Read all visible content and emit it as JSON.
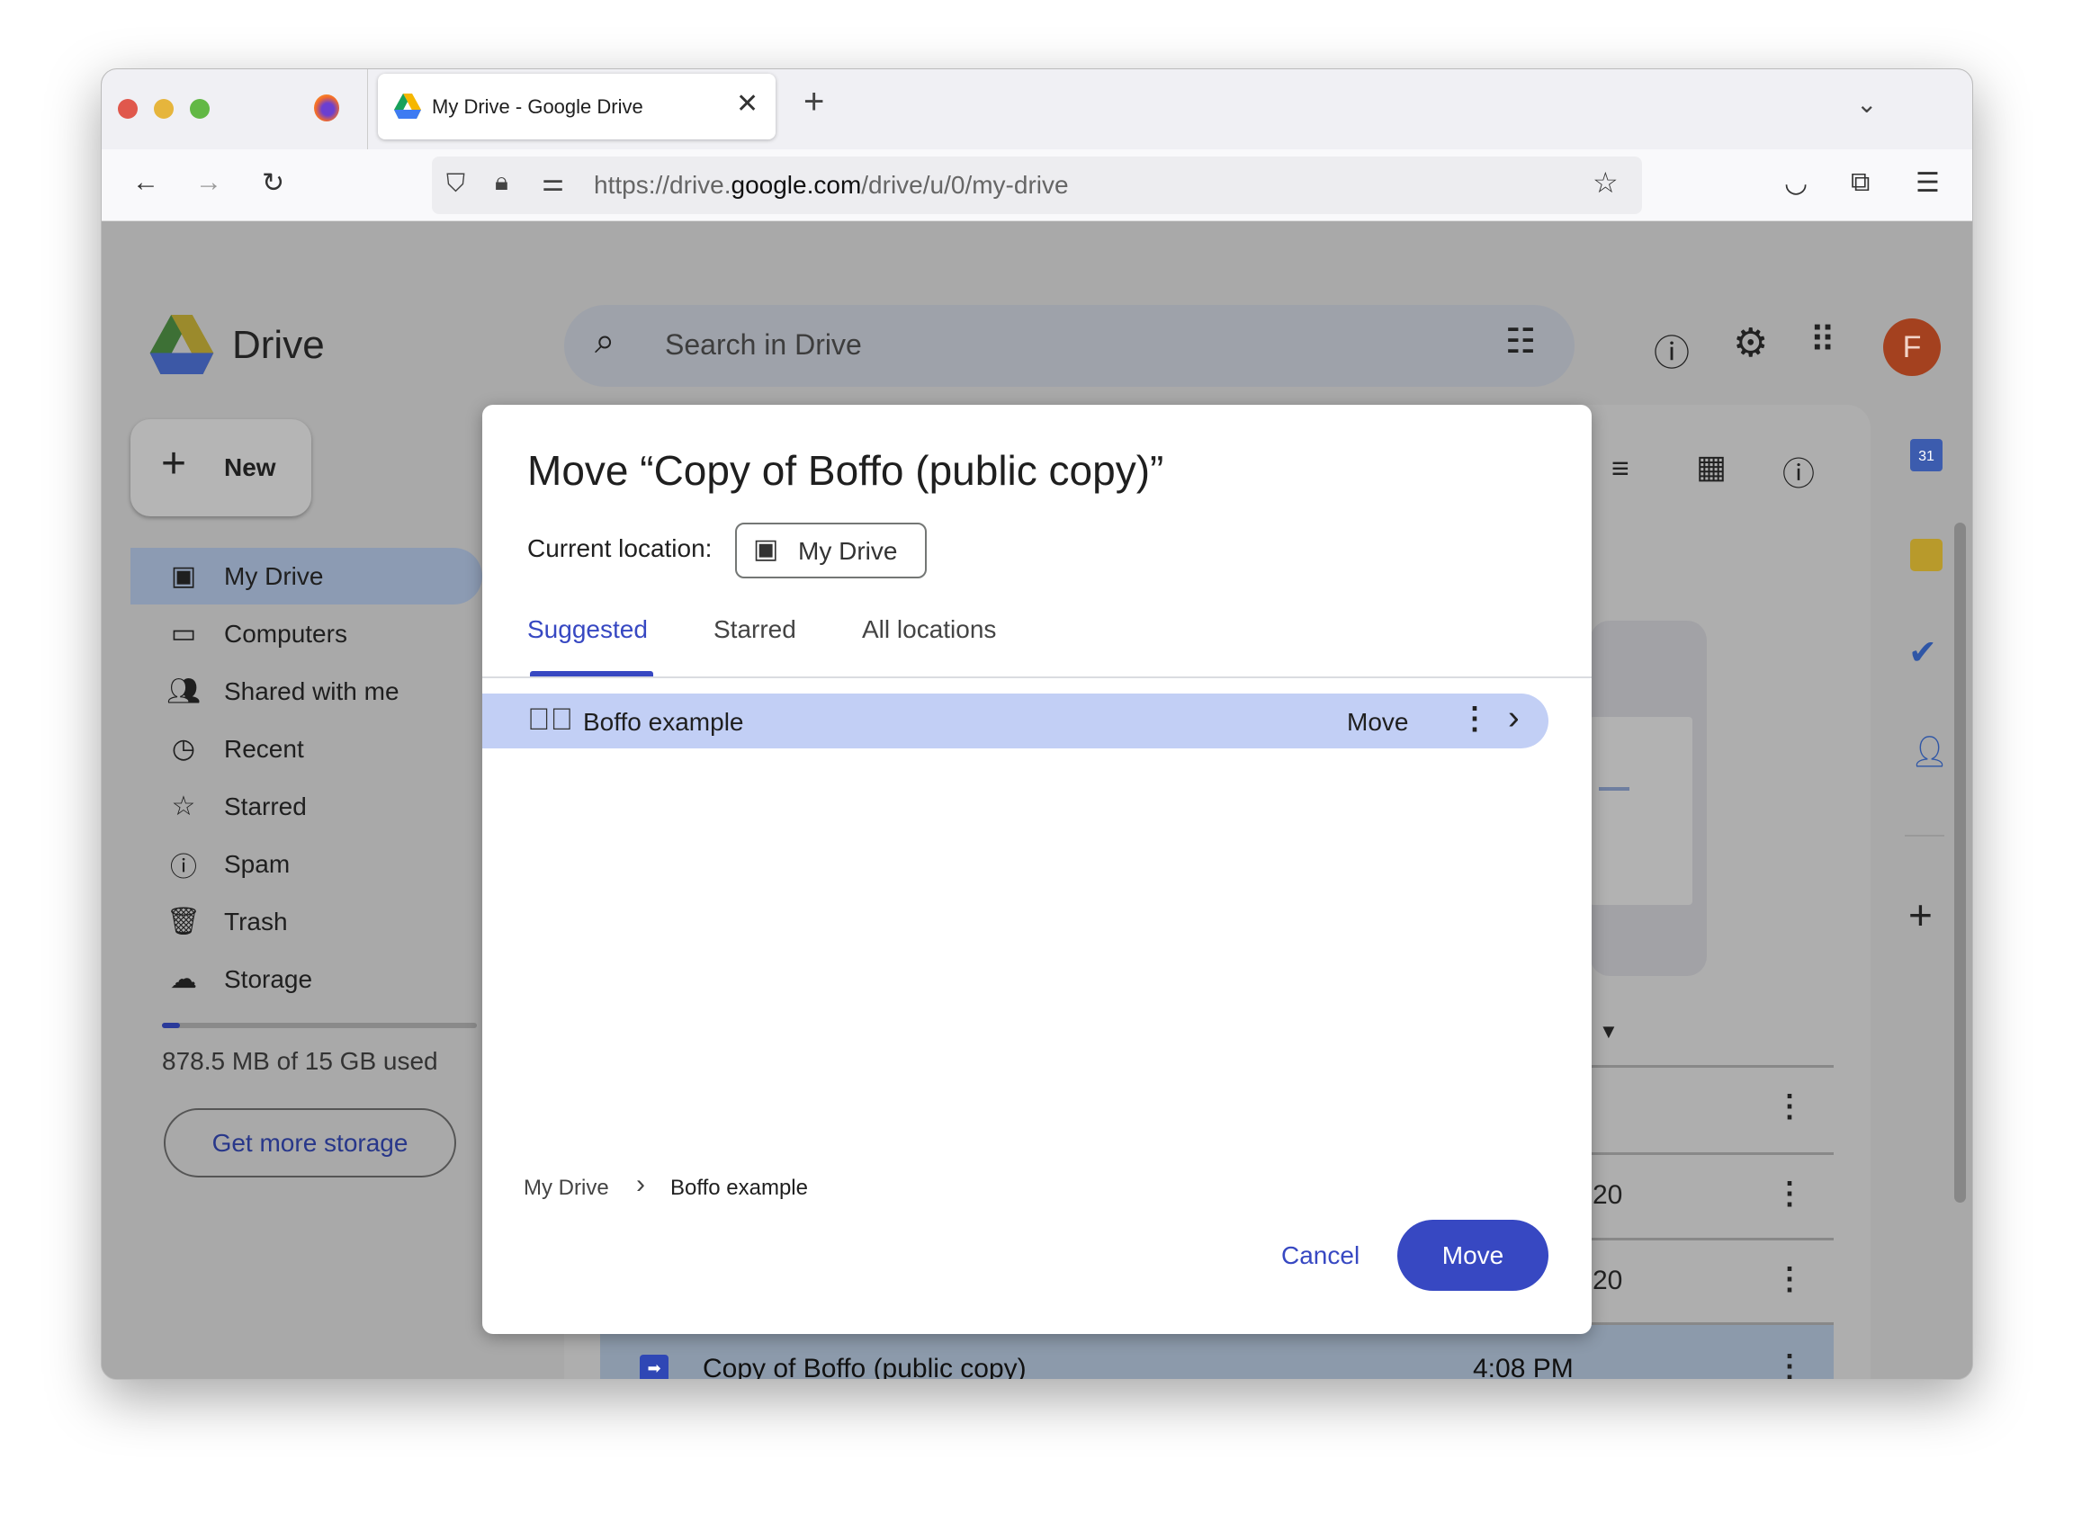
{
  "browser": {
    "tab_title": "My Drive - Google Drive",
    "url_prefix": "https://drive.",
    "url_domain": "google.com",
    "url_path": "/drive/u/0/my-drive"
  },
  "app": {
    "name": "Drive",
    "search_placeholder": "Search in Drive",
    "avatar_letter": "F",
    "new_label": "New",
    "avatar_color": "#a4411f"
  },
  "sidebar": {
    "items": [
      {
        "label": "My Drive",
        "icon": "my-drive-icon"
      },
      {
        "label": "Computers",
        "icon": "computers-icon"
      },
      {
        "label": "Shared with me",
        "icon": "shared-icon"
      },
      {
        "label": "Recent",
        "icon": "clock-icon"
      },
      {
        "label": "Starred",
        "icon": "star-icon"
      },
      {
        "label": "Spam",
        "icon": "spam-icon"
      },
      {
        "label": "Trash",
        "icon": "trash-icon"
      },
      {
        "label": "Storage",
        "icon": "cloud-icon"
      }
    ],
    "storage_text": "878.5 MB of 15 GB used",
    "storage_used_fraction": 0.057,
    "get_storage_label": "Get more storage"
  },
  "file_list": {
    "rows": [
      {
        "date": ""
      },
      {
        "date": "20"
      },
      {
        "date": "20"
      },
      {
        "name": "Copy of Boffo (public copy)",
        "date": "4:08 PM",
        "selected": true
      }
    ]
  },
  "dialog": {
    "title": "Move “Copy of Boffo (public copy)”",
    "current_location_label": "Current location:",
    "current_location_value": "My Drive",
    "tabs": [
      {
        "label": "Suggested",
        "active": true
      },
      {
        "label": "Starred"
      },
      {
        "label": "All locations"
      }
    ],
    "folder_row": {
      "name": "Boffo example",
      "move_label": "Move"
    },
    "breadcrumb": [
      "My Drive",
      "Boffo example"
    ],
    "cancel_label": "Cancel",
    "move_label": "Move",
    "accent": "#3748c2"
  }
}
